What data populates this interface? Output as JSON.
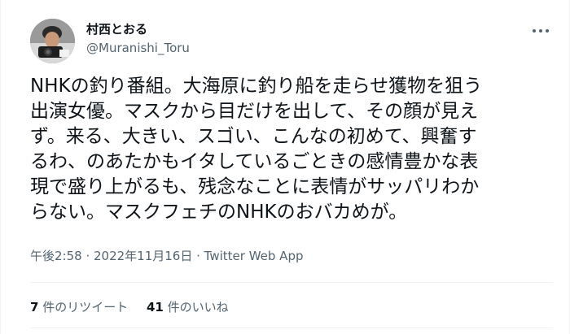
{
  "author": {
    "display_name": "村西とおる",
    "handle": "@Muranishi_Toru"
  },
  "tweet": {
    "lines": [
      "NHKの釣り番組。大海原に釣り船を走らせ獲物を狙う",
      "出演女優。マスクから目だけを出して、その顔が見え",
      "ず。来る、大きい、スゴい、こんなの初めて、興奮す",
      "るわ、のあたかもイタしているごときの感情豊かな表",
      "現で盛り上がるも、残念なことに表情がサッパリわか",
      "らない。マスクフェチのNHKのおバカめが。"
    ]
  },
  "meta": {
    "time": "午後2:58",
    "separator": " · ",
    "date": "2022年11月16日",
    "app": "Twitter Web App"
  },
  "stats": {
    "retweets_count": "7",
    "retweets_label": " 件のリツイート",
    "likes_count": "41",
    "likes_label": " 件のいいね"
  },
  "icons": {
    "more": "more-horizontal-icon"
  }
}
